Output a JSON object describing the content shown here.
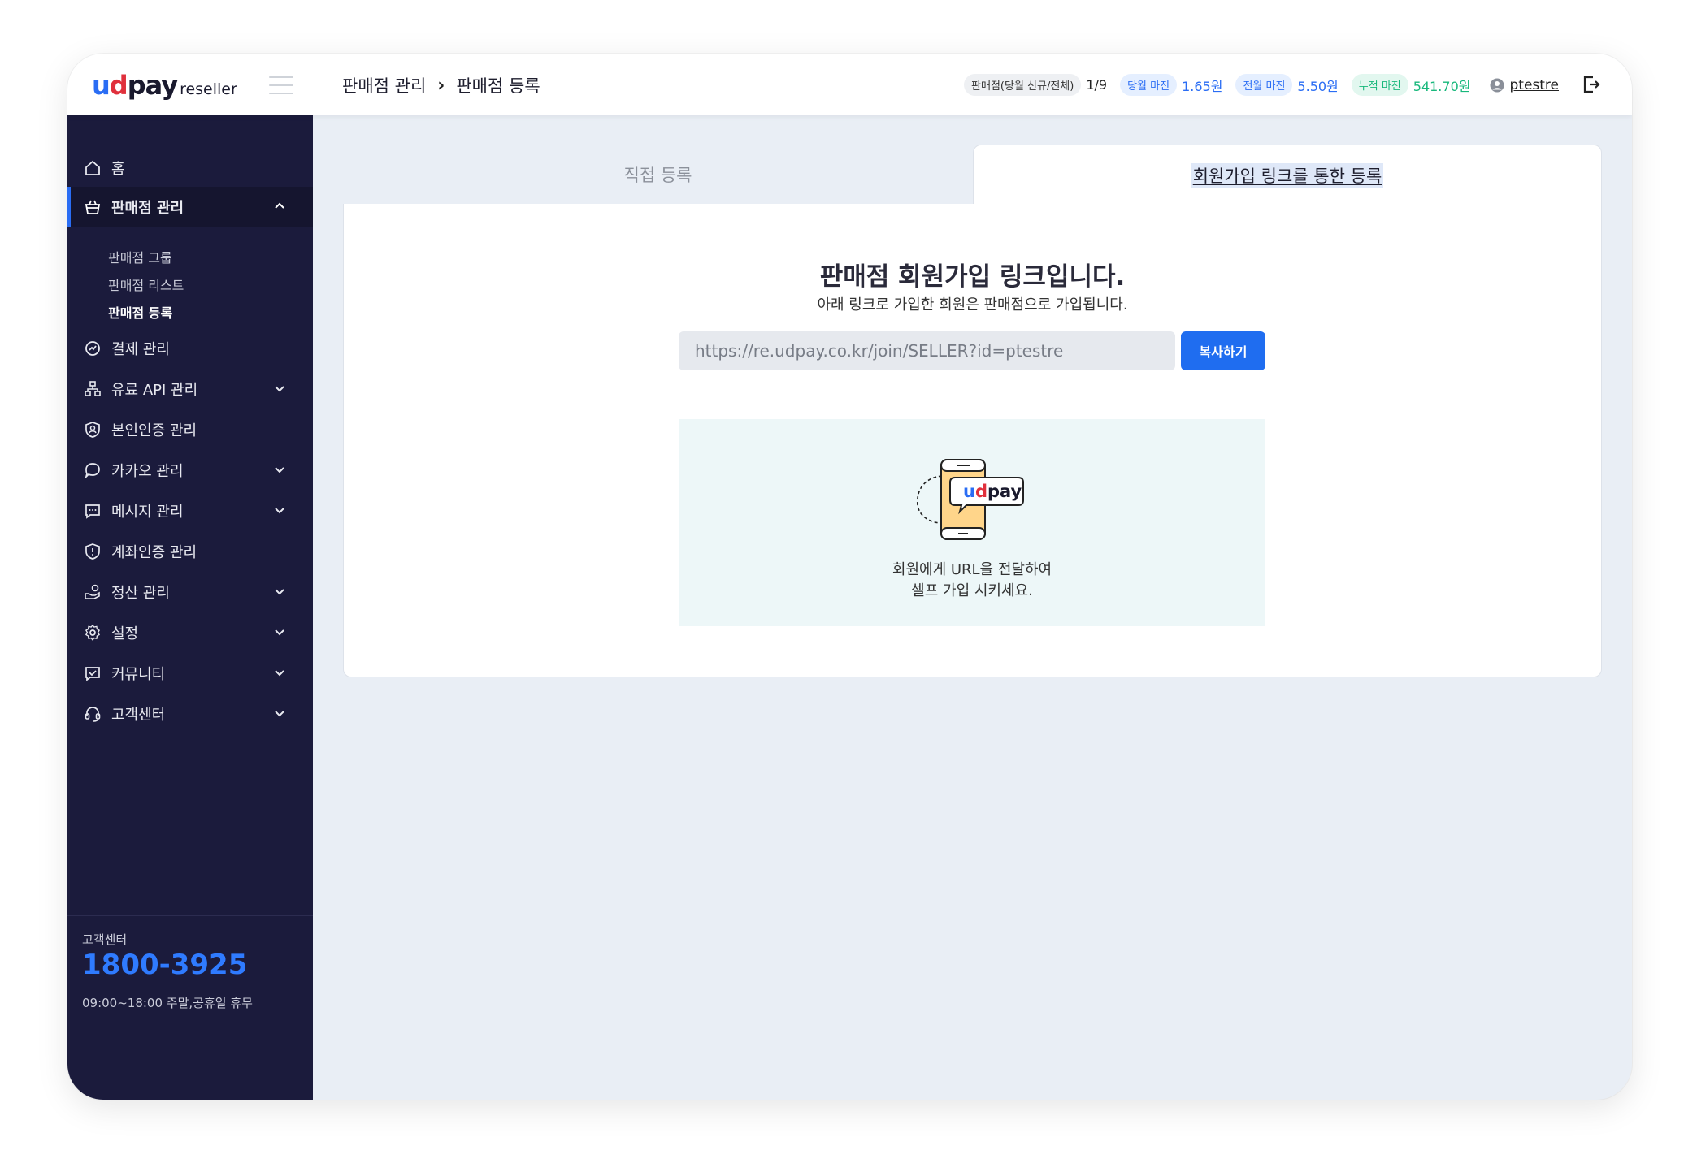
{
  "header": {
    "logo_main_u": "u",
    "logo_main_d": "d",
    "logo_main_rest": "pay",
    "logo_sub": "reseller",
    "breadcrumb": [
      "판매점 관리",
      "판매점 등록"
    ],
    "breadcrumb_sep": "›",
    "stats": {
      "seller_label": "판매점(당월 신규/전체)",
      "seller_value": "1/9",
      "month_margin_label": "당월 마진",
      "month_margin_value": "1.65원",
      "prev_margin_label": "전월 마진",
      "prev_margin_value": "5.50원",
      "total_margin_label": "누적 마진",
      "total_margin_value": "541.70원"
    },
    "username": "ptestre"
  },
  "sidebar": {
    "items": [
      {
        "label": "홈",
        "icon": "home-icon"
      },
      {
        "label": "판매점 관리",
        "icon": "store-icon"
      },
      {
        "label": "결제 관리",
        "icon": "payment-icon"
      },
      {
        "label": "유료 API 관리",
        "icon": "api-icon"
      },
      {
        "label": "본인인증 관리",
        "icon": "identity-icon"
      },
      {
        "label": "카카오 관리",
        "icon": "chat-bubble-icon"
      },
      {
        "label": "메시지 관리",
        "icon": "message-icon"
      },
      {
        "label": "계좌인증 관리",
        "icon": "shield-icon"
      },
      {
        "label": "정산 관리",
        "icon": "settlement-icon"
      },
      {
        "label": "설정",
        "icon": "gear-icon"
      },
      {
        "label": "커뮤니티",
        "icon": "community-icon"
      },
      {
        "label": "고객센터",
        "icon": "headset-icon"
      }
    ],
    "sub_items": [
      "판매점 그룹",
      "판매점 리스트",
      "판매점 등록"
    ],
    "cs_label": "고객센터",
    "cs_phone": "1800-3925",
    "cs_hours": "09:00~18:00  주말,공휴일 휴무"
  },
  "tabs": [
    {
      "label": "직접 등록",
      "active": false
    },
    {
      "label": "회원가입 링크를 통한 등록",
      "active": true
    }
  ],
  "panel": {
    "title": "판매점 회원가입 링크입니다.",
    "description": "아래 링크로 가입한 회원은 판매점으로 가입됩니다.",
    "url": "https://re.udpay.co.kr/join/SELLER?id=ptestre",
    "copy_label": "복사하기",
    "illu_logo_u": "u",
    "illu_logo_d": "d",
    "illu_logo_rest": "pay",
    "info_line1": "회원에게 URL을 전달하여",
    "info_line2": "셀프 가입 시키세요."
  },
  "colors": {
    "accent": "#1f6df0",
    "sidebar_bg": "#1b1b3c",
    "content_bg": "#e9eef5",
    "green": "#18b87c"
  }
}
